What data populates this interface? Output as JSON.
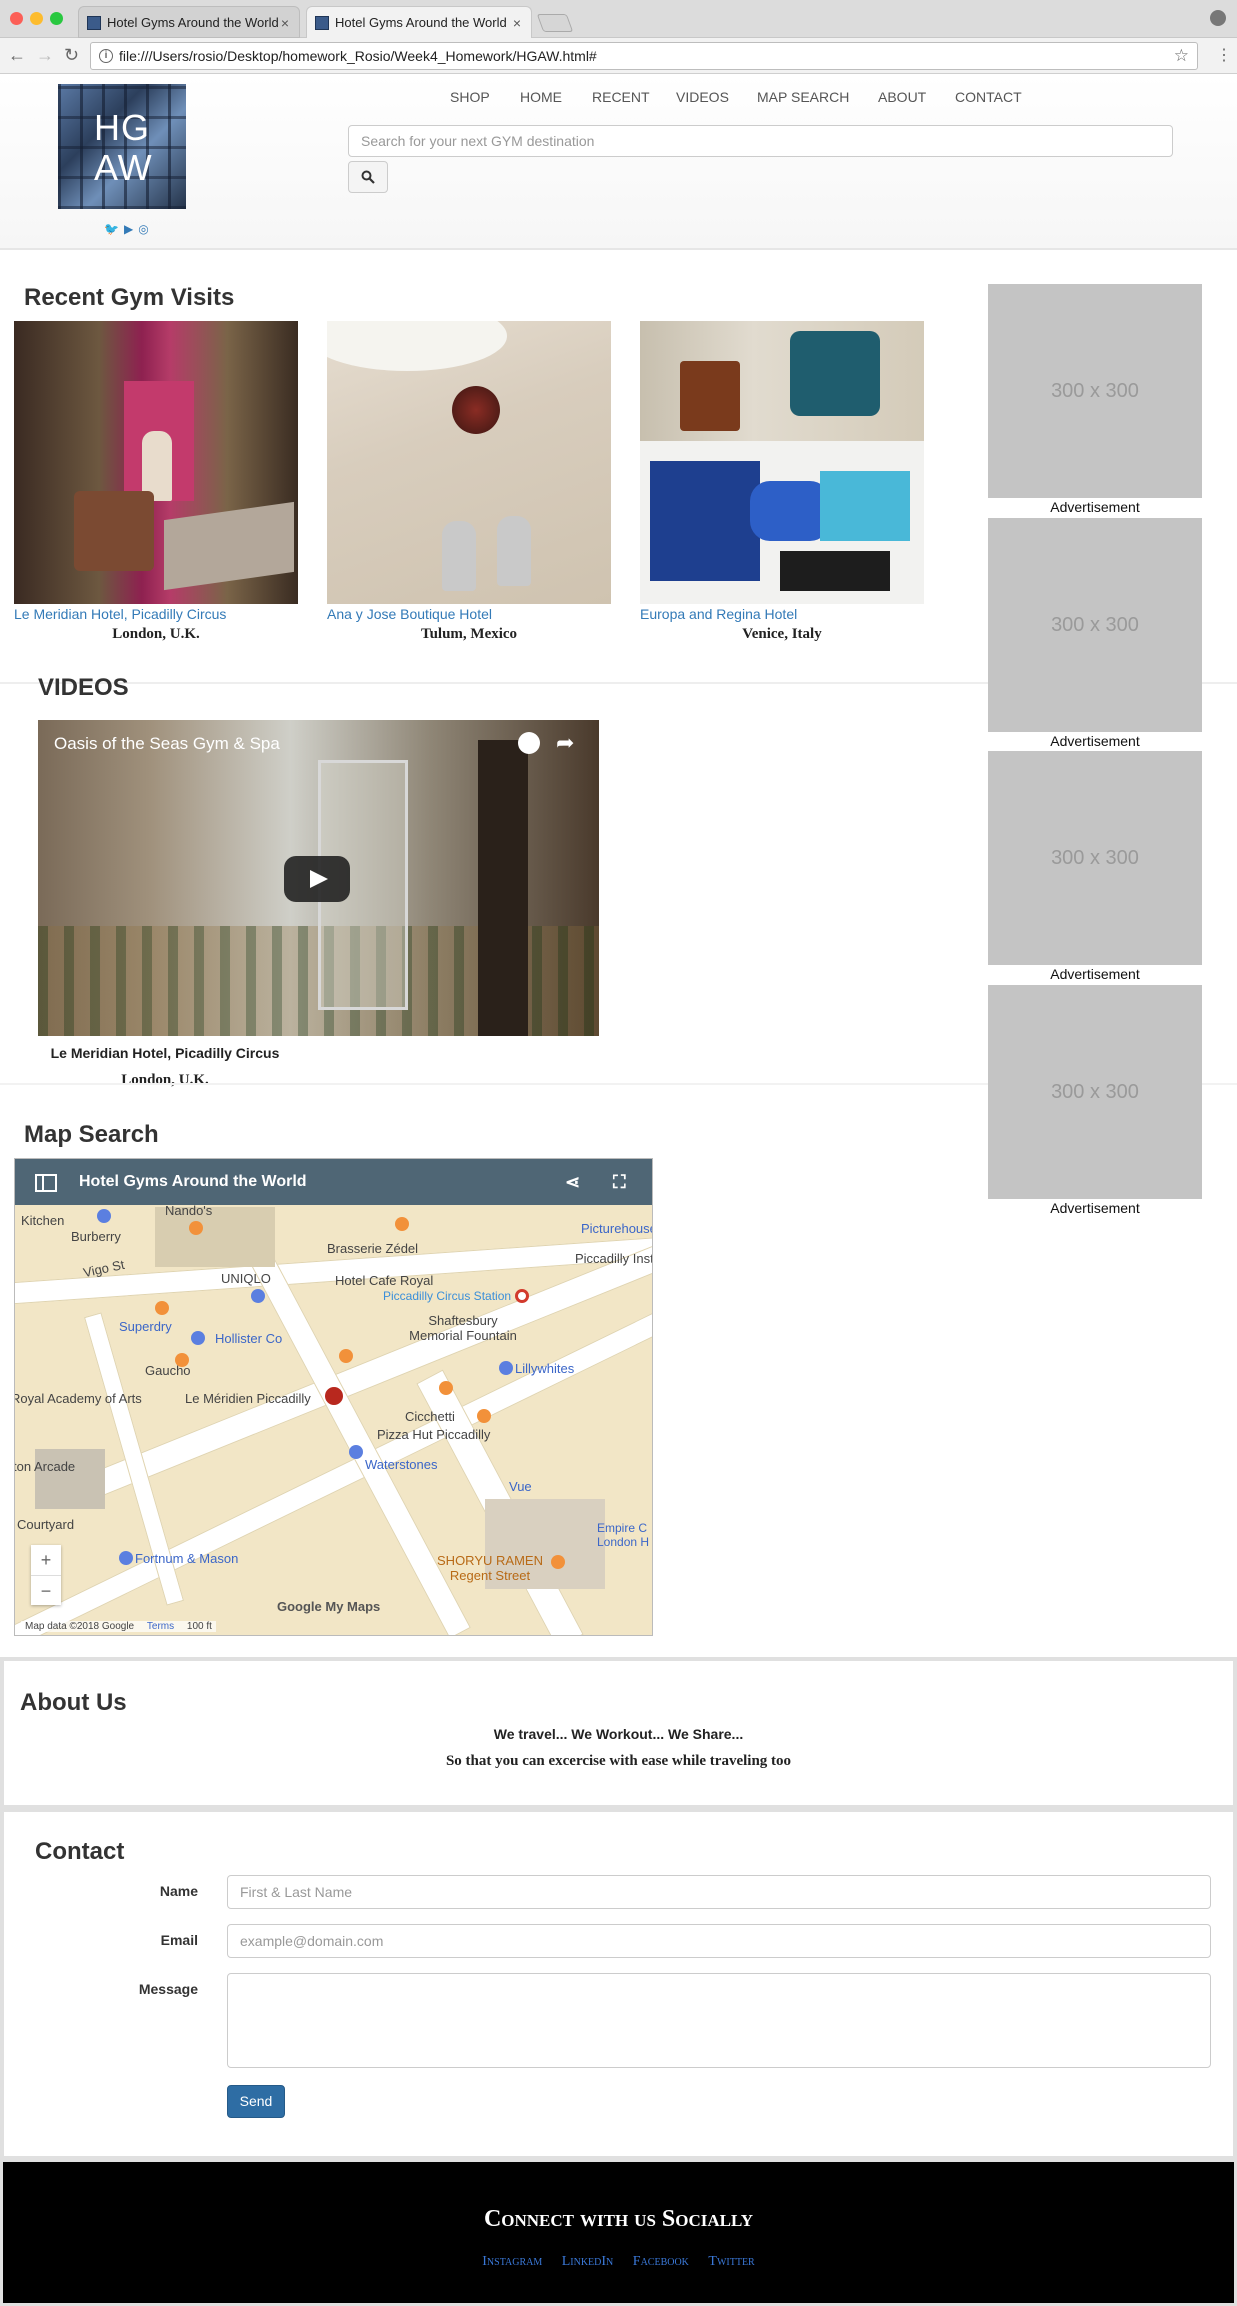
{
  "browser": {
    "tabs": [
      {
        "title": "Hotel Gyms Around the World",
        "active": false
      },
      {
        "title": "Hotel Gyms Around the World",
        "active": true
      }
    ],
    "url": "file:///Users/rosio/Desktop/homework_Rosio/Week4_Homework/HGAW.html#"
  },
  "header": {
    "logo_text": "HG AW",
    "nav": [
      "SHOP",
      "HOME",
      "RECENT",
      "VIDEOS",
      "MAP SEARCH",
      "ABOUT",
      "CONTACT"
    ],
    "search_placeholder": "Search for your next GYM destination",
    "social_icons": [
      "twitter-icon",
      "youtube-icon",
      "instagram-icon"
    ]
  },
  "recent": {
    "title": "Recent Gym Visits",
    "items": [
      {
        "hotel": "Le Meridian Hotel, Picadilly Circus",
        "location": "London, U.K."
      },
      {
        "hotel": "Ana y Jose Boutique Hotel",
        "location": "Tulum, Mexico"
      },
      {
        "hotel": "Europa and Regina Hotel",
        "location": "Venice, Italy"
      }
    ]
  },
  "ads": {
    "placeholder": "300 x 300",
    "label": "Advertisement"
  },
  "videos": {
    "title": "VIDEOS",
    "video_title": "Oasis of the Seas Gym & Spa",
    "caption_hotel": "Le Meridian Hotel, Picadilly Circus",
    "caption_location": "London, U.K."
  },
  "map": {
    "title": "Map Search",
    "map_name": "Hotel Gyms Around the World",
    "labels": [
      "Kitchen",
      "Nando's",
      "Brasserie Zédel",
      "Picturehouse Cent",
      "Burberry",
      "Piccadilly Institu",
      "Vigo St",
      "UNIQLO",
      "Hotel Cafe Royal",
      "Piccadilly Circus Station",
      "Superdry",
      "Hollister Co",
      "Shaftesbury Memorial Fountain",
      "Gaucho",
      "Lillywhites",
      "Royal Academy of Arts",
      "Le Méridien Piccadilly",
      "Cicchetti",
      "Pizza Hut Piccadilly",
      "Waterstones",
      "ton Arcade",
      "Vue",
      "Courtyard",
      "Fortnum & Mason",
      "SHORYU RAMEN Regent Street",
      "Empire C London H"
    ],
    "attribution": "Map data ©2018 Google",
    "google": "Google My Maps",
    "terms": "Terms",
    "scale": "100 ft"
  },
  "about": {
    "title": "About Us",
    "line1": "We travel... We Workout... We Share...",
    "line2": "So that you can excercise with ease while traveling too"
  },
  "contact": {
    "title": "Contact",
    "name_label": "Name",
    "name_placeholder": "First & Last Name",
    "email_label": "Email",
    "email_placeholder": "example@domain.com",
    "message_label": "Message",
    "send_label": "Send"
  },
  "footer": {
    "title": "Connect with us Socially",
    "links": [
      "Instagram",
      "LinkedIn",
      "Facebook",
      "Twitter"
    ]
  }
}
